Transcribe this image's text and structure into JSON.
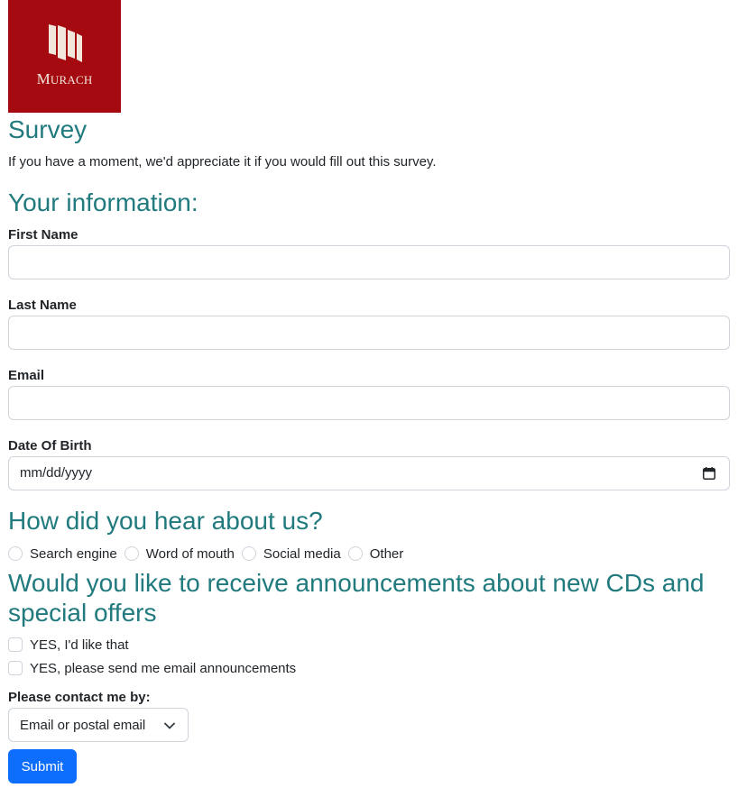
{
  "logo": {
    "text_first": "M",
    "text_rest": "URACH"
  },
  "page": {
    "title": "Survey",
    "intro": "If you have a moment, we'd appreciate it if you would fill out this survey."
  },
  "info_section": {
    "heading": "Your information:",
    "first_name_label": "First Name",
    "last_name_label": "Last Name",
    "email_label": "Email",
    "dob_label": "Date Of Birth",
    "dob_placeholder": "mm/dd/yyyy"
  },
  "hear_section": {
    "heading": "How did you hear about us?",
    "options": [
      "Search engine",
      "Word of mouth",
      "Social media",
      "Other"
    ]
  },
  "announce_section": {
    "heading_line1": "Would you like to receive announcements about new CDs and",
    "heading_line2": "special offers",
    "checkboxes": [
      "YES, I'd like that",
      "YES, please send me email announcements"
    ]
  },
  "contact": {
    "label": "Please contact me by:",
    "selected": "Email or postal email"
  },
  "submit_label": "Submit",
  "colors": {
    "heading": "#207a7e",
    "logo_bg": "#a50a10",
    "button": "#0d6efd",
    "border": "#ced4da"
  },
  "icons": [
    "murach-logo-icon",
    "calendar-icon",
    "chevron-down-icon"
  ]
}
